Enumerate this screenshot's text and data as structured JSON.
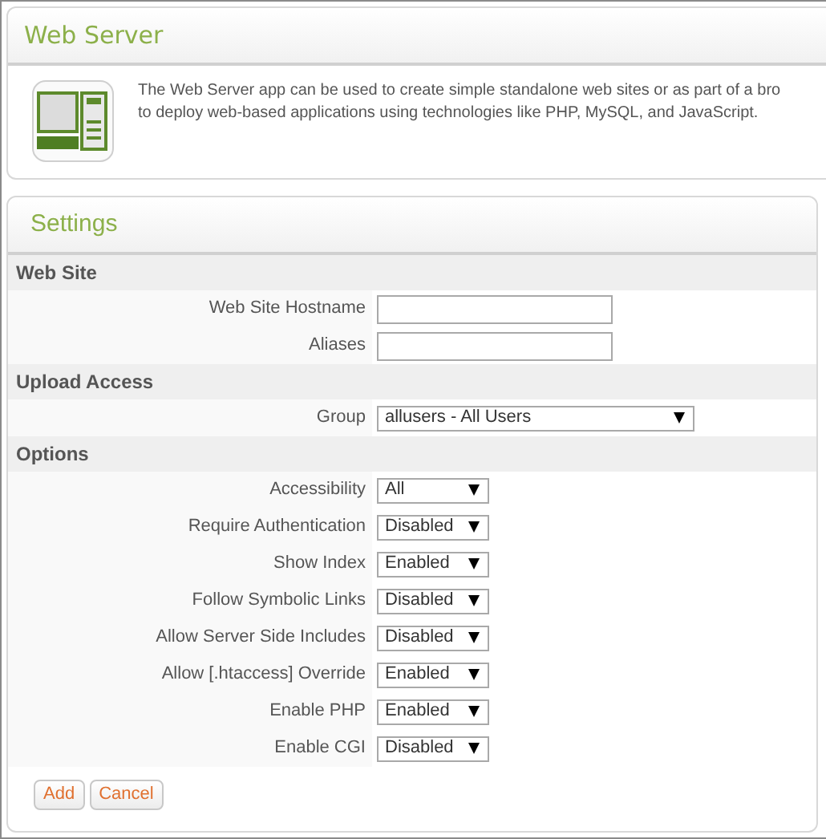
{
  "app_card": {
    "title": "Web Server",
    "description_lines": [
      "The Web Server app can be used to create simple standalone web sites or as part of a bro",
      "to deploy web-based applications using technologies like PHP, MySQL, and JavaScript."
    ]
  },
  "settings": {
    "title": "Settings",
    "sections": [
      {
        "heading": "Web Site",
        "fields": [
          {
            "kind": "text",
            "label": "Web Site Hostname"
          },
          {
            "kind": "text",
            "label": "Aliases"
          }
        ]
      },
      {
        "heading": "Upload Access",
        "fields": [
          {
            "kind": "select",
            "label": "Group",
            "value": "allusers - All Users"
          }
        ]
      },
      {
        "heading": "Options",
        "fields": [
          {
            "kind": "select",
            "label": "Accessibility",
            "value": "All"
          },
          {
            "kind": "select",
            "label": "Require Authentication",
            "value": "Disabled"
          },
          {
            "kind": "select",
            "label": "Show Index",
            "value": "Enabled"
          },
          {
            "kind": "select",
            "label": "Follow Symbolic Links",
            "value": "Disabled"
          },
          {
            "kind": "select",
            "label": "Allow Server Side Includes",
            "value": "Disabled"
          },
          {
            "kind": "select",
            "label": "Allow [.htaccess] Override",
            "value": "Enabled"
          },
          {
            "kind": "select",
            "label": "Enable PHP",
            "value": "Enabled"
          },
          {
            "kind": "select",
            "label": "Enable CGI",
            "value": "Disabled"
          }
        ]
      }
    ],
    "buttons": [
      "Add",
      "Cancel"
    ]
  }
}
